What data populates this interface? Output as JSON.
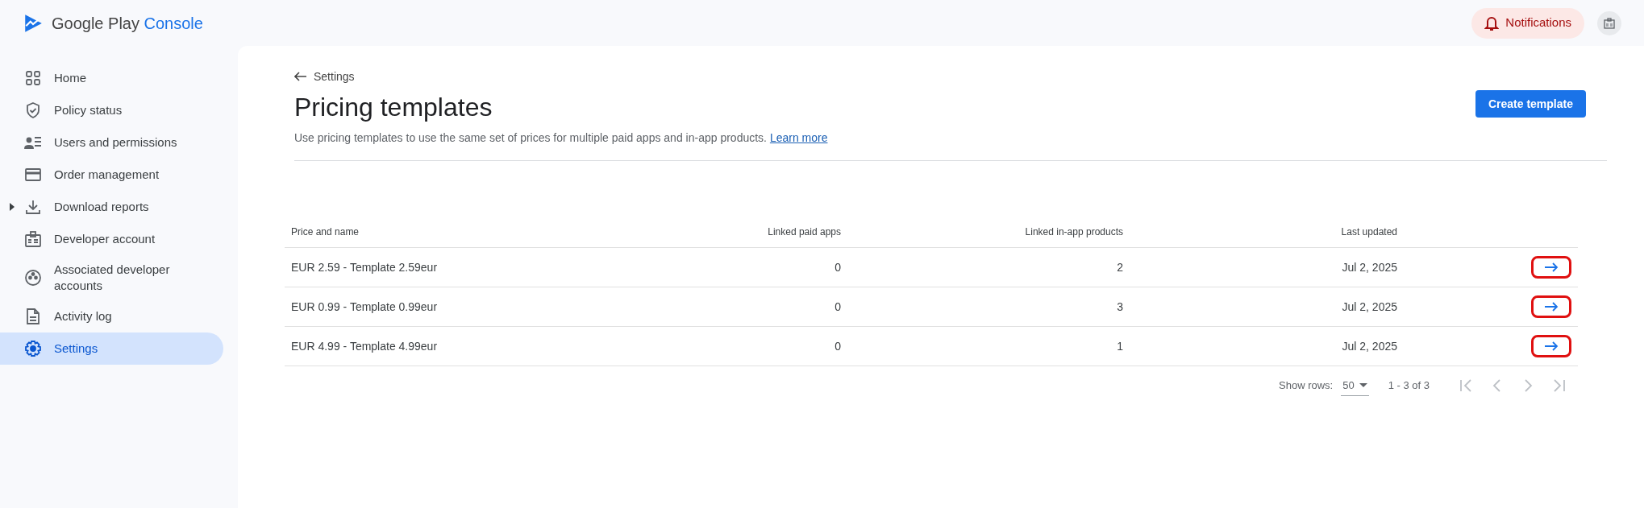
{
  "app": {
    "brand_first": "Google Play",
    "brand_second": "Console"
  },
  "header": {
    "notifications_label": "Notifications"
  },
  "sidebar": {
    "items": [
      {
        "kind": "home",
        "label": "Home",
        "selected": false
      },
      {
        "kind": "shield",
        "label": "Policy status",
        "selected": false
      },
      {
        "kind": "users",
        "label": "Users and permissions",
        "selected": false
      },
      {
        "kind": "card",
        "label": "Order management",
        "selected": false
      },
      {
        "kind": "download",
        "label": "Download reports",
        "selected": false,
        "expandable": true
      },
      {
        "kind": "badge",
        "label": "Developer account",
        "selected": false
      },
      {
        "kind": "circle",
        "label": "Associated developer accounts",
        "selected": false
      },
      {
        "kind": "doc",
        "label": "Activity log",
        "selected": false
      },
      {
        "kind": "gear",
        "label": "Settings",
        "selected": true
      }
    ]
  },
  "page": {
    "back_label": "Settings",
    "title": "Pricing templates",
    "description": "Use pricing templates to use the same set of prices for multiple paid apps and in-app products.",
    "learn_more": "Learn more",
    "create_button": "Create template"
  },
  "table": {
    "columns": [
      "Price and name",
      "Linked paid apps",
      "Linked in-app products",
      "Last updated"
    ],
    "rows": [
      {
        "cells": [
          "EUR 2.59 - Template 2.59eur",
          "0",
          "2",
          "Jul 2, 2025"
        ],
        "highlighted": true
      },
      {
        "cells": [
          "EUR 0.99 - Template 0.99eur",
          "0",
          "3",
          "Jul 2, 2025"
        ],
        "highlighted": true
      },
      {
        "cells": [
          "EUR 4.99 - Template 4.99eur",
          "0",
          "1",
          "Jul 2, 2025"
        ],
        "highlighted": true
      }
    ]
  },
  "pagination": {
    "show_rows_label": "Show rows:",
    "rows_value": "50",
    "range": "1 - 3 of 3"
  }
}
